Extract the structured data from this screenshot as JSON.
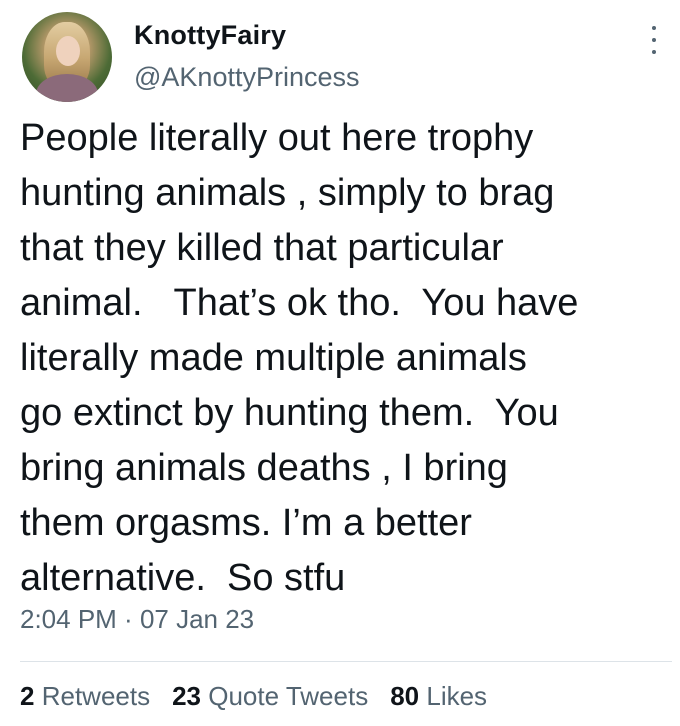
{
  "author": {
    "display_name": "KnottyFairy",
    "handle": "@AKnottyPrincess"
  },
  "tweet": {
    "lines": [
      "People literally out here trophy",
      "hunting animals , simply to brag",
      "that they killed that particular",
      "animal.   That’s ok tho.  You have",
      "literally made multiple animals",
      "go extinct by hunting them.  You",
      "bring animals deaths , I bring",
      "them orgasms. I’m a better",
      "alternative.  So stfu"
    ],
    "time": "2:04 PM",
    "separator": " · ",
    "date": "07 Jan 23"
  },
  "stats": {
    "retweets_count": "2",
    "retweets_label": "Retweets",
    "quote_tweets_count": "23",
    "quote_tweets_label": "Quote Tweets",
    "likes_count": "80",
    "likes_label": "Likes"
  },
  "icons": {
    "more": "more-options-icon"
  },
  "colors": {
    "text_primary": "#0f1419",
    "text_secondary": "#536471",
    "divider": "#dde3e8"
  }
}
